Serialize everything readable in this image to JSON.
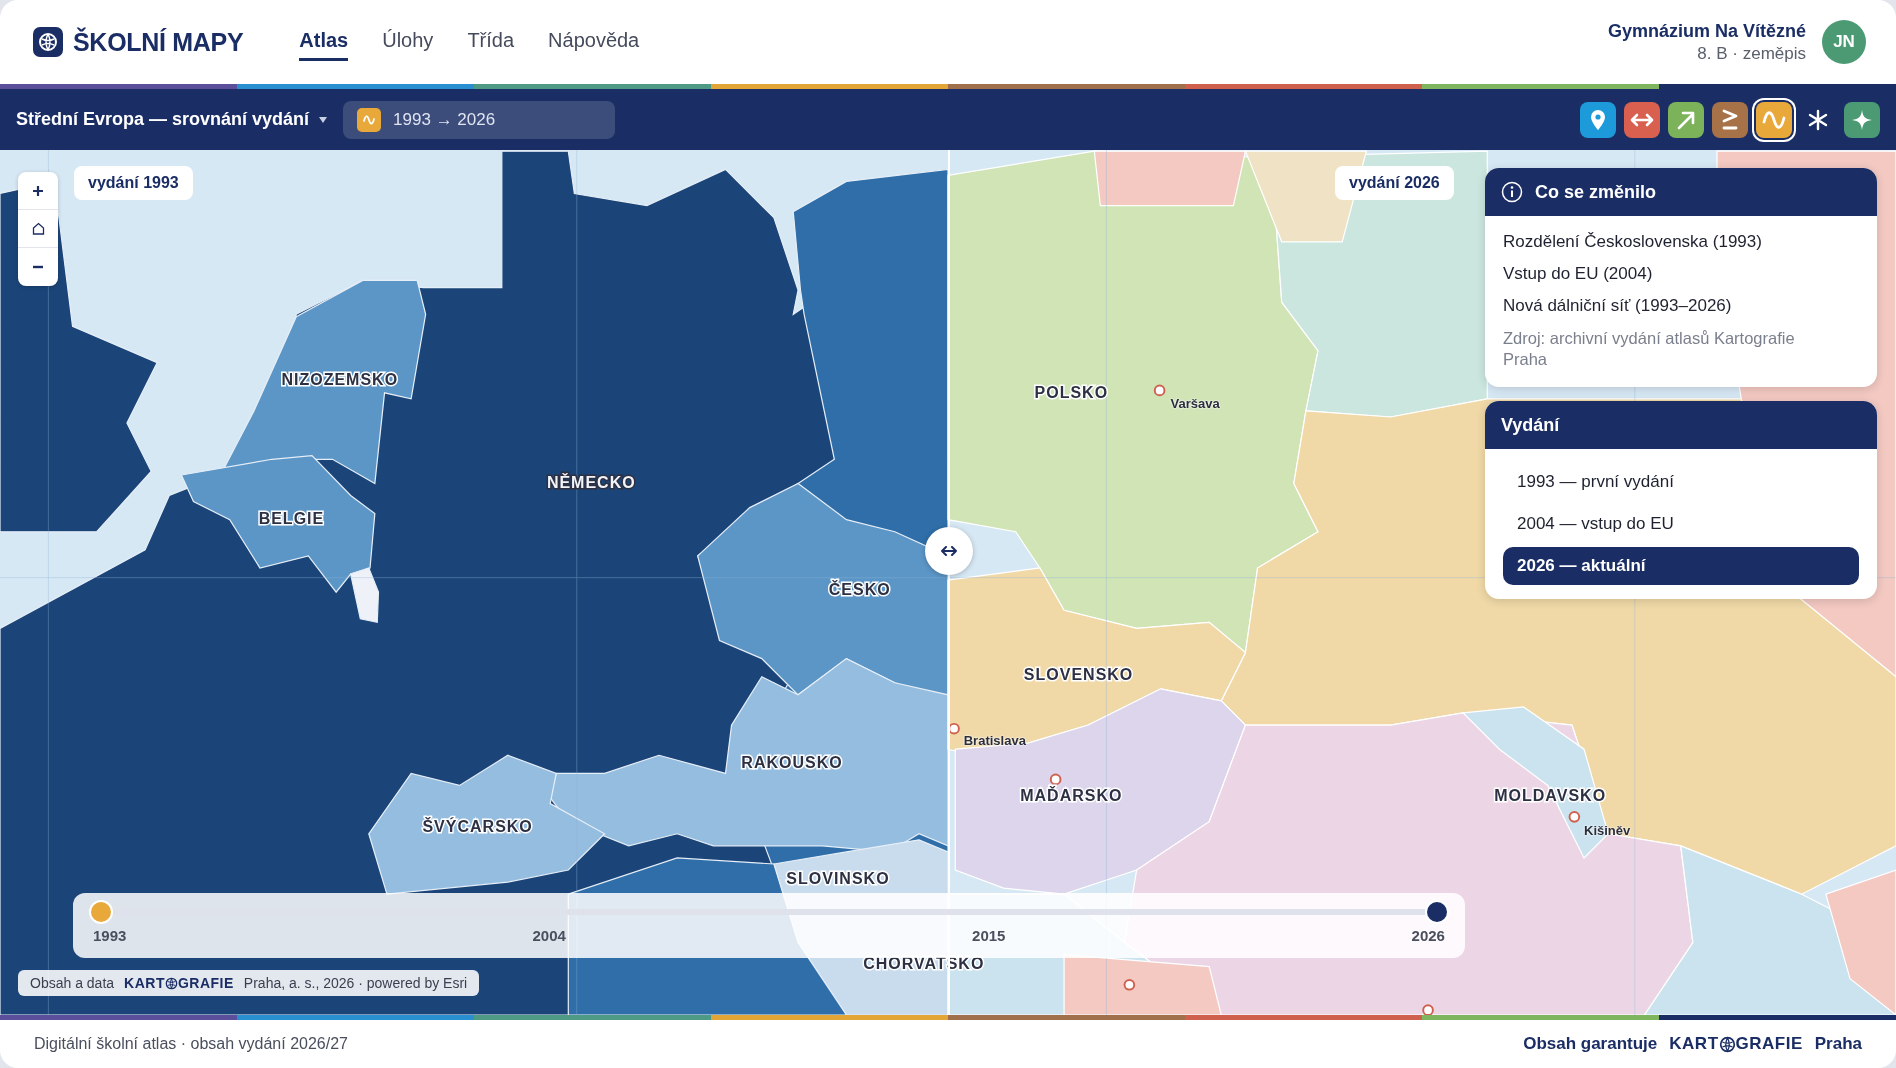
{
  "brand": {
    "name": "ŠKOLNÍ MAPY"
  },
  "nav": [
    {
      "label": "Atlas",
      "selected": true
    },
    {
      "label": "Úlohy",
      "selected": false
    },
    {
      "label": "Třída",
      "selected": false
    },
    {
      "label": "Nápověda",
      "selected": false
    }
  ],
  "user": {
    "school": "Gymnázium Na Vítězné",
    "class": "8. B · zeměpis",
    "initials": "JN"
  },
  "toolbar": {
    "title": "Střední Evropa — srovnání vydání",
    "range": "1993 → 2026",
    "tools": [
      {
        "kind": "pin",
        "selected": false
      },
      {
        "kind": "arrows",
        "selected": false
      },
      {
        "kind": "diagonal",
        "selected": false
      },
      {
        "kind": "gte",
        "selected": false
      },
      {
        "kind": "wave",
        "selected": true
      },
      {
        "kind": "asterisk",
        "selected": false
      },
      {
        "kind": "sparkle",
        "selected": false
      }
    ]
  },
  "map": {
    "left_label": "vydání 1993",
    "right_label": "vydání 2026",
    "country_labels": [
      "NIZOZEMSKO",
      "BELGIE",
      "NĚMECKO",
      "ČESKO",
      "RAKOUSKO",
      "ŠVÝCARSKO",
      "SLOVINSKO",
      "CHORVATSKO",
      "POLSKO",
      "SLOVENSKO",
      "MAĎARSKO",
      "MOLDAVSKO"
    ],
    "cities": [
      "Varšava",
      "Bratislava",
      "Kišiněv"
    ]
  },
  "changes": {
    "title": "Co se změnilo",
    "items": [
      "Rozdělení Československa (1993)",
      "Vstup do EU (2004)",
      "Nová dálniční síť (1993–2026)"
    ],
    "source": "Zdroj: archivní vydání atlasů Kartografie Praha"
  },
  "editions": {
    "title": "Vydání",
    "items": [
      {
        "label": "1993 — první vydání",
        "selected": false
      },
      {
        "label": "2004 — vstup do EU",
        "selected": false
      },
      {
        "label": "2026 — aktuální",
        "selected": true
      }
    ]
  },
  "timeline": {
    "ticks": [
      "1993",
      "2004",
      "2015",
      "2026"
    ],
    "thumbs": [
      {
        "level": 0
      },
      {
        "level": 1
      }
    ]
  },
  "attribution": {
    "prefix": "Obsah a data",
    "brand_start": "KART",
    "brand_end": "GRAFIE",
    "suffix": "Praha, a. s., 2026 · powered by Esri"
  },
  "footer": {
    "text": "Digitální školní atlas · obsah vydání 2026/27",
    "guarantee": "Obsah garantuje",
    "brand_start": "KART",
    "brand_end": "GRAFIE",
    "city": "Praha"
  }
}
